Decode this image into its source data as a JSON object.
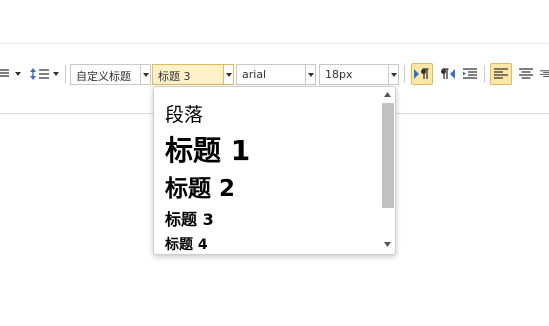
{
  "toolbar": {
    "custom_title_select": "自定义标题",
    "paragraph_format_select": "标题 3",
    "font_family_select": "arial",
    "font_size_select": "18px"
  },
  "dropdown": {
    "options": [
      "段落",
      "标题 1",
      "标题 2",
      "标题 3",
      "标题 4"
    ]
  },
  "colors": {
    "active_fill": "#fff2c8",
    "active_border": "#e2b964",
    "scroll_thumb": "#c1c1c1"
  }
}
